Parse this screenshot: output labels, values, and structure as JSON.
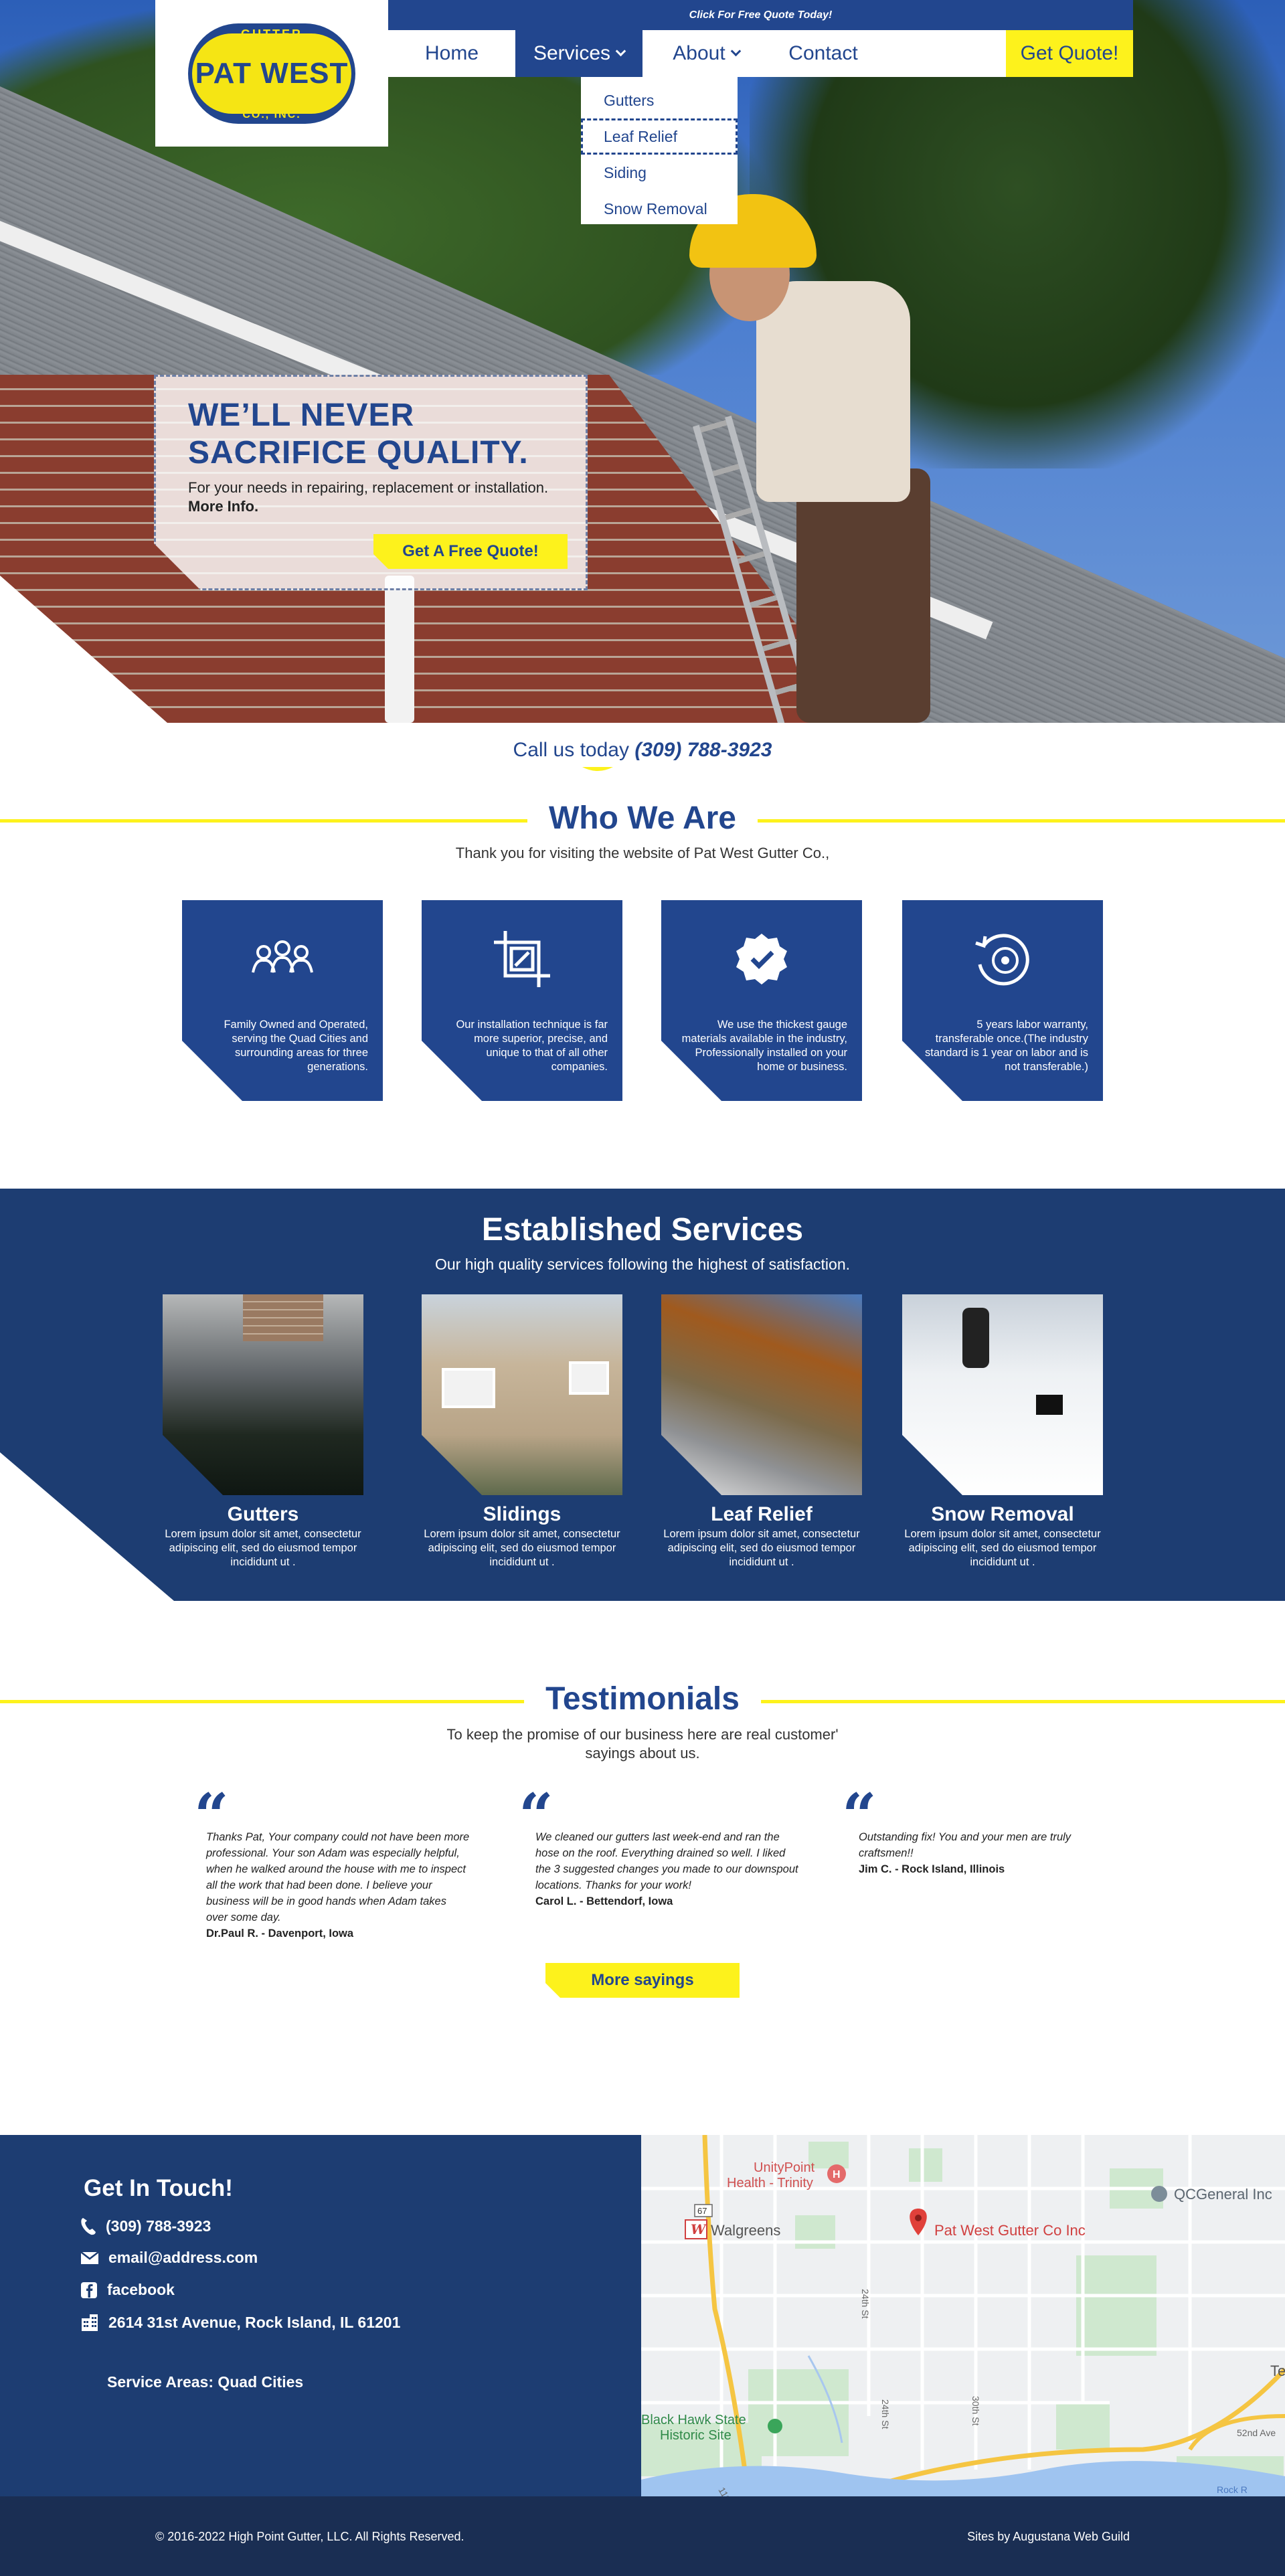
{
  "topbar": {
    "text": "Click For Free Quote Today!"
  },
  "logo": {
    "top_text": "GUTTER",
    "main_text": "PAT WEST",
    "bottom_text": "CO., INC."
  },
  "nav": {
    "home": "Home",
    "services": "Services",
    "about": "About",
    "contact": "Contact",
    "quote": "Get Quote!"
  },
  "dropdown": {
    "items": [
      {
        "label": "Gutters"
      },
      {
        "label": "Leaf Relief"
      },
      {
        "label": "Siding"
      },
      {
        "label": "Snow Removal"
      }
    ]
  },
  "hero": {
    "title_line1": "WE’LL NEVER",
    "title_line2": "SACRIFICE QUALITY.",
    "subtitle": "For your needs in repairing, replacement or installation.",
    "more_link": "More Info.",
    "button": "Get A Free Quote!"
  },
  "call": {
    "prefix": "Call us today",
    "phone": "(309) 788-3923"
  },
  "who": {
    "title": "Who We Are",
    "subtitle": "Thank you for visiting the website of Pat West Gutter Co.,",
    "features": [
      {
        "icon": "family-icon",
        "text": "Family Owned and Operated, serving the  Quad Cities and surrounding areas for three generations."
      },
      {
        "icon": "crop-tool-icon",
        "text": "Our installation technique is far more superior, precise, and unique to that of all other companies."
      },
      {
        "icon": "verified-badge-icon",
        "text": "We use the thickest gauge materials available in the industry, Professionally installed on your home or business."
      },
      {
        "icon": "warranty-restore-icon",
        "text": "5 years labor warranty, transferable once.(The industry standard is 1 year on labor and is not transferable.)"
      }
    ]
  },
  "services": {
    "title": "Established Services",
    "subtitle": "Our high quality services following the highest of satisfaction.",
    "items": [
      {
        "name": "Gutters",
        "desc": "Lorem ipsum dolor sit amet, consectetur adipiscing elit, sed do eiusmod tempor incididunt ut ."
      },
      {
        "name": "Slidings",
        "desc": "Lorem ipsum dolor sit amet, consectetur adipiscing elit, sed do eiusmod tempor incididunt ut ."
      },
      {
        "name": "Leaf Relief",
        "desc": "Lorem ipsum dolor sit amet, consectetur adipiscing elit, sed do eiusmod tempor incididunt ut ."
      },
      {
        "name": "Snow Removal",
        "desc": "Lorem ipsum dolor sit amet, consectetur adipiscing elit, sed do eiusmod tempor incididunt ut ."
      }
    ]
  },
  "testimonials": {
    "title": "Testimonials",
    "subtitle_line1": "To keep the promise of our business here are real customer'",
    "subtitle_line2": "sayings about us.",
    "quotes": [
      {
        "text": "Thanks Pat, Your company could not have been more professional. Your son Adam was especially helpful, when he walked  around the house with me to inspect all the work that had been done. I believe your business will be in good hands when Adam takes over some day.",
        "author": "Dr.Paul R. - Davenport, Iowa"
      },
      {
        "text": "We cleaned our gutters last week-end and ran the hose on the roof. Everything drained so well. I liked the 3 suggested changes you made to our downspout locations. Thanks for your work!",
        "author": "Carol L. - Bettendorf, Iowa"
      },
      {
        "text": "Outstanding fix! You and your men are truly craftsmen!!",
        "author": "Jim C. - Rock Island, Illinois"
      }
    ],
    "more_button": "More sayings"
  },
  "contact": {
    "title": "Get In Touch!",
    "phone": "(309) 788-3923",
    "email": "email@address.com",
    "facebook": "facebook",
    "address": "2614 31st Avenue, Rock Island, IL 61201",
    "service_areas": "Service Areas: Quad Cities"
  },
  "map": {
    "labels": {
      "hospital": "UnityPoint Health - Trinity",
      "business": "QCGeneral Inc",
      "pharmacy": "Walgreens",
      "marker": "Pat West Gutter Co Inc",
      "park": "Black Hawk State Historic Site",
      "road1": "24th St",
      "road2": "24th St",
      "road3": "30th St",
      "road4": "52nd Ave",
      "road5": "11th St",
      "highway": "67",
      "edge_text": "Te",
      "river": "Rock R"
    }
  },
  "footer": {
    "copyright": "© 2016-2022 High Point Gutter, LLC. All Rights Reserved.",
    "credit": "Sites by Augustana Web Guild"
  },
  "colors": {
    "primary": "#22468e",
    "navy": "#1d3d72",
    "accent": "#fdf21c",
    "footer": "#1a2e53"
  }
}
